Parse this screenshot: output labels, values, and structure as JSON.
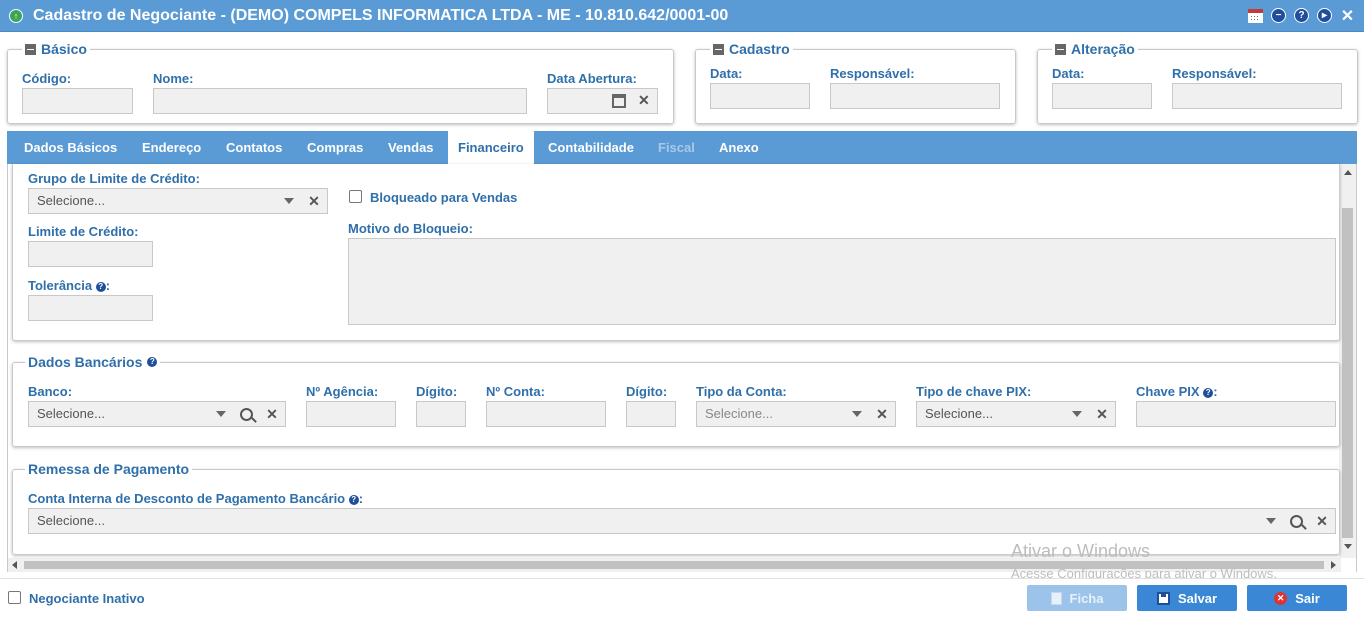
{
  "window": {
    "title": "Cadastro de Negociante - (DEMO) COMPELS INFORMATICA LTDA - ME - 10.810.642/0001-00"
  },
  "basico": {
    "legend": "Básico",
    "codigo_label": "Código:",
    "codigo_value": "",
    "nome_label": "Nome:",
    "nome_value": "",
    "data_abertura_label": "Data Abertura:",
    "data_abertura_value": ""
  },
  "cadastro": {
    "legend": "Cadastro",
    "data_label": "Data:",
    "responsavel_label": "Responsável:"
  },
  "alteracao": {
    "legend": "Alteração",
    "data_label": "Data:",
    "responsavel_label": "Responsável:"
  },
  "tabs": [
    {
      "label": "Dados Básicos",
      "state": "normal"
    },
    {
      "label": "Endereço",
      "state": "normal"
    },
    {
      "label": "Contatos",
      "state": "normal"
    },
    {
      "label": "Compras",
      "state": "normal"
    },
    {
      "label": "Vendas",
      "state": "normal"
    },
    {
      "label": "Financeiro",
      "state": "active"
    },
    {
      "label": "Contabilidade",
      "state": "normal"
    },
    {
      "label": "Fiscal",
      "state": "disabled"
    },
    {
      "label": "Anexo",
      "state": "normal"
    }
  ],
  "financeiro": {
    "grupo_limite_label": "Grupo de Limite de Crédito:",
    "grupo_limite_value": "Selecione...",
    "bloqueado_label": "Bloqueado para Vendas",
    "bloqueado_checked": false,
    "limite_credito_label": "Limite de Crédito:",
    "motivo_bloqueio_label": "Motivo do Bloqueio:",
    "tolerancia_label": "Tolerância"
  },
  "dados_bancarios": {
    "legend": "Dados Bancários",
    "banco_label": "Banco:",
    "banco_value": "Selecione...",
    "agencia_label": "Nº Agência:",
    "digito_label": "Dígito:",
    "conta_label": "Nº Conta:",
    "digito2_label": "Dígito:",
    "tipo_conta_label": "Tipo da Conta:",
    "tipo_conta_value": "Selecione...",
    "tipo_pix_label": "Tipo de chave PIX:",
    "tipo_pix_value": "Selecione...",
    "chave_pix_label": "Chave PIX"
  },
  "remessa": {
    "legend": "Remessa de Pagamento",
    "conta_interna_label": "Conta Interna de Desconto de Pagamento Bancário",
    "conta_interna_value": "Selecione..."
  },
  "footer": {
    "inativo_label": "Negociante Inativo",
    "ficha_label": "Ficha",
    "salvar_label": "Salvar",
    "sair_label": "Sair"
  },
  "watermark": {
    "line1": "Ativar o Windows",
    "line2": "Acesse Configurações para ativar o Windows."
  },
  "colors": {
    "titlebar": "#5b9bd5",
    "label": "#2f6faa",
    "button": "#3a87d6"
  }
}
